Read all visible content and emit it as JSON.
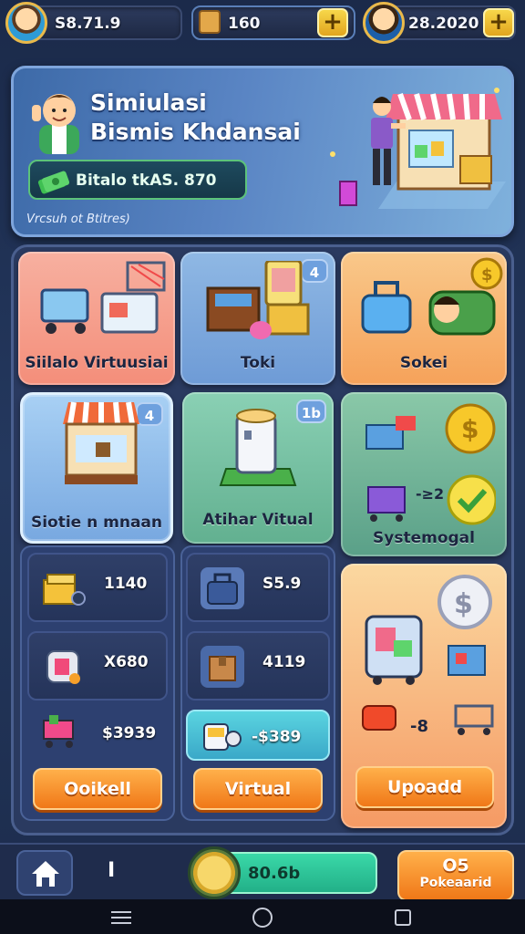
{
  "topbar": {
    "left_value": "S8.71.9",
    "center_value": "160",
    "right_value": "28.2020",
    "plus_symbol": "+"
  },
  "banner": {
    "title_line1": "Simiulasi",
    "title_line2": "Bismis Khdansai",
    "balance": "Bitalo tkAS. 870",
    "subtitle": "Vrcsuh ot Btitres)"
  },
  "cards": {
    "market": {
      "label": "Siilalo Virtuusiai"
    },
    "toko": {
      "label": "Toki",
      "badge": "4"
    },
    "sokel": {
      "label": "Sokei"
    },
    "stall": {
      "label": "Siotie n mnaan",
      "badge": "4"
    },
    "archive": {
      "label": "Atihar Vitual",
      "badge": "1b"
    },
    "system": {
      "label": "Systemogal",
      "arrow_text": "-≥2"
    },
    "upgrade": {
      "arrow_text": "-8"
    }
  },
  "mini_items": [
    {
      "value": "1140",
      "icon": "gold-bars-icon"
    },
    {
      "value": "X680",
      "icon": "safe-icon"
    },
    {
      "value": "S5.9",
      "icon": "bag-icon"
    },
    {
      "value": "4119",
      "icon": "box-icon"
    },
    {
      "value": "$3939",
      "icon": "cart-icon"
    },
    {
      "value": "-$389",
      "icon": "cash-machine-icon"
    }
  ],
  "buttons": {
    "ookell": "Ooikell",
    "virtual": "Virtual",
    "upgrade": "Upoadd"
  },
  "bottombar": {
    "home_icon": "home-icon",
    "counter": "I",
    "coins": "80.6b",
    "badge_top": "O5",
    "badge_bottom": "Pokeaarid"
  },
  "colors": {
    "accent_orange": "#f07818",
    "accent_green": "#2fbf8a",
    "panel_bg": "#2a3a60",
    "gold": "#f7d74a"
  }
}
